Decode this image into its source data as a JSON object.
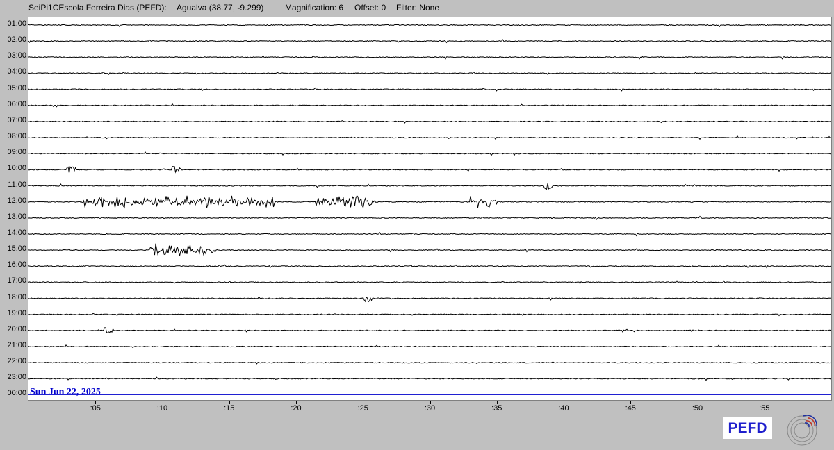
{
  "header": {
    "station": "SeiPi1CEscola Ferreira Dias (PEFD):",
    "location": "Agualva (38.77, -9.299)",
    "magnification": "Magnification: 6",
    "offset": "Offset: 0",
    "filter": "Filter: None"
  },
  "plot": {
    "hour_labels": [
      "01:00",
      "02:00",
      "03:00",
      "04:00",
      "05:00",
      "06:00",
      "07:00",
      "08:00",
      "09:00",
      "10:00",
      "11:00",
      "12:00",
      "13:00",
      "14:00",
      "15:00",
      "16:00",
      "17:00",
      "18:00",
      "19:00",
      "20:00",
      "21:00",
      "22:00",
      "23:00",
      "00:00"
    ],
    "minute_labels": [
      ":05",
      ":10",
      ":15",
      ":20",
      ":25",
      ":30",
      ":35",
      ":40",
      ":45",
      ":50",
      ":55"
    ],
    "date_label": "Sun Jun 22, 2025",
    "trace_color": "#000000",
    "current_trace_color": "#0000cc",
    "activity": [
      {
        "hour": "10:00",
        "minutes": [
          3.2,
          11.1
        ]
      },
      {
        "hour": "11:00",
        "minutes": [
          38.9
        ]
      },
      {
        "hour": "12:00",
        "minutes_range": [
          [
            4.0,
            18.5
          ],
          [
            21.5,
            26.0
          ],
          [
            33.0,
            35.0
          ]
        ]
      },
      {
        "hour": "15:00",
        "minutes_range": [
          [
            9.0,
            14.0
          ]
        ]
      },
      {
        "hour": "18:00",
        "minutes": [
          25.3
        ]
      },
      {
        "hour": "20:00",
        "minutes": [
          6.0
        ]
      }
    ]
  },
  "logo": {
    "text": "PEFD",
    "emblem_name": "seismograph-emblem",
    "text_color": "#1e1ecc"
  }
}
